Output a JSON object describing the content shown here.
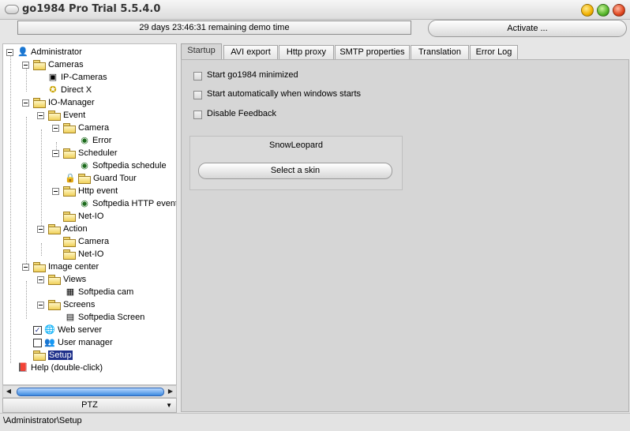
{
  "window": {
    "title": "go1984 Pro Trial 5.5.4.0"
  },
  "demo_notice": "29 days 23:46:31 remaining demo time",
  "activate_label": "Activate ...",
  "tree": {
    "administrator": "Administrator",
    "cameras": "Cameras",
    "ip_cameras": "IP-Cameras",
    "direct_x": "Direct X",
    "io_manager": "IO-Manager",
    "event": "Event",
    "camera": "Camera",
    "error": "Error",
    "scheduler": "Scheduler",
    "softpedia_schedule": "Softpedia schedule",
    "guard_tour": "Guard Tour",
    "http_event": "Http event",
    "softpedia_http_event": "Softpedia HTTP event",
    "net_io": "Net-IO",
    "action": "Action",
    "action_camera": "Camera",
    "action_net_io": "Net-IO",
    "image_center": "Image center",
    "views": "Views",
    "softpedia_cam": "Softpedia cam",
    "screens": "Screens",
    "softpedia_screen": "Softpedia Screen",
    "web_server": "Web server",
    "user_manager": "User manager",
    "setup": "Setup",
    "help": "Help (double-click)"
  },
  "ptz_label": "PTZ",
  "tabs": [
    "Startup",
    "AVI export",
    "Http proxy",
    "SMTP properties",
    "Translation",
    "Error Log"
  ],
  "startup": {
    "options": [
      "Start go1984 minimized",
      "Start automatically when windows starts",
      "Disable Feedback"
    ],
    "skin_name": "SnowLeopard",
    "select_skin_label": "Select a skin"
  },
  "status_path": "\\Administrator\\Setup",
  "colors": {
    "selection": "#1d2f8a",
    "scroll_thumb": "#3c8ae0",
    "panel_bg": "#d6d6d6"
  }
}
